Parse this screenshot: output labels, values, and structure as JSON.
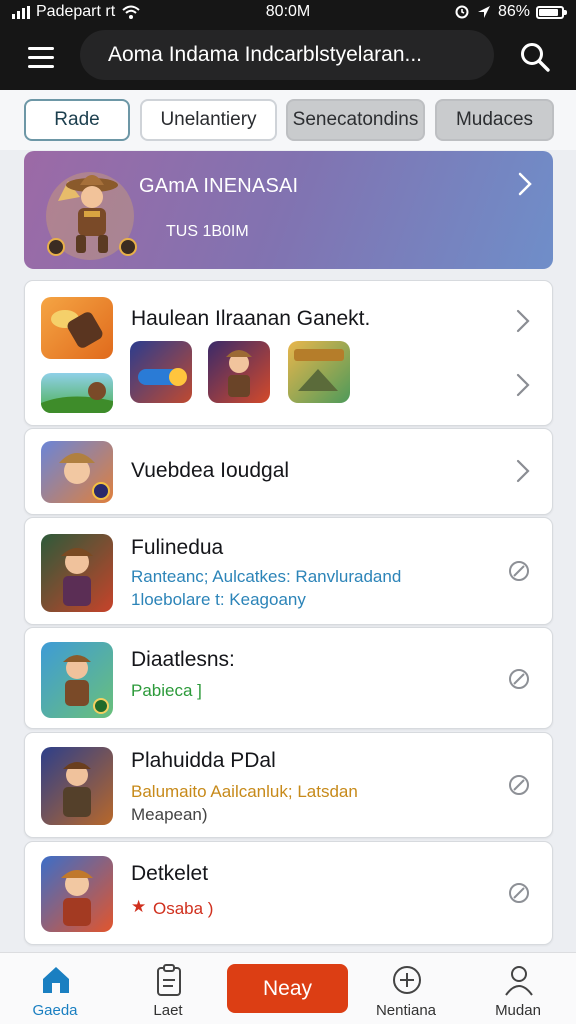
{
  "status_bar": {
    "carrier": "Padepart rt",
    "time": "80:0M",
    "battery": "86%"
  },
  "header": {
    "search_value": "Aoma  Indama  Indcarblstyelaran..."
  },
  "filters": {
    "chips": [
      "Rade",
      "Unelantiery",
      "Senecatondins",
      "Mudaces"
    ]
  },
  "banner": {
    "title": "GAmA INENASAI",
    "subtitle": "TUS 1B0IM"
  },
  "cards": {
    "c1": {
      "title": "Haulean Ilraanan Ganekt."
    },
    "c2": {
      "title": "Vuebdea Ioudgal"
    },
    "c3": {
      "title": "Fulinedua",
      "line1": "Ranteanc; Aulcatkes: Ranvluradand",
      "line2": "1loebolare t: Keagoany"
    },
    "c4": {
      "title": "Diaatlesns:",
      "line1": "Pabieca ]"
    },
    "c5": {
      "title": "Plahuidda PDal",
      "line1": "Balumaito Aailcanluk; Latsdan",
      "line2": "Meapean)"
    },
    "c6": {
      "title": "Detkelet",
      "line1": "Osaba )"
    }
  },
  "colors": {
    "link_blue": "#2c84b8",
    "link_green": "#2c9a3a",
    "link_amber": "#c78a1a",
    "link_red": "#d0301e",
    "cta": "#dc3e14"
  },
  "tabbar": {
    "tabs": [
      "Gaeda",
      "Laet",
      "Nentiana",
      "Mudan"
    ],
    "cta": "Neay"
  }
}
